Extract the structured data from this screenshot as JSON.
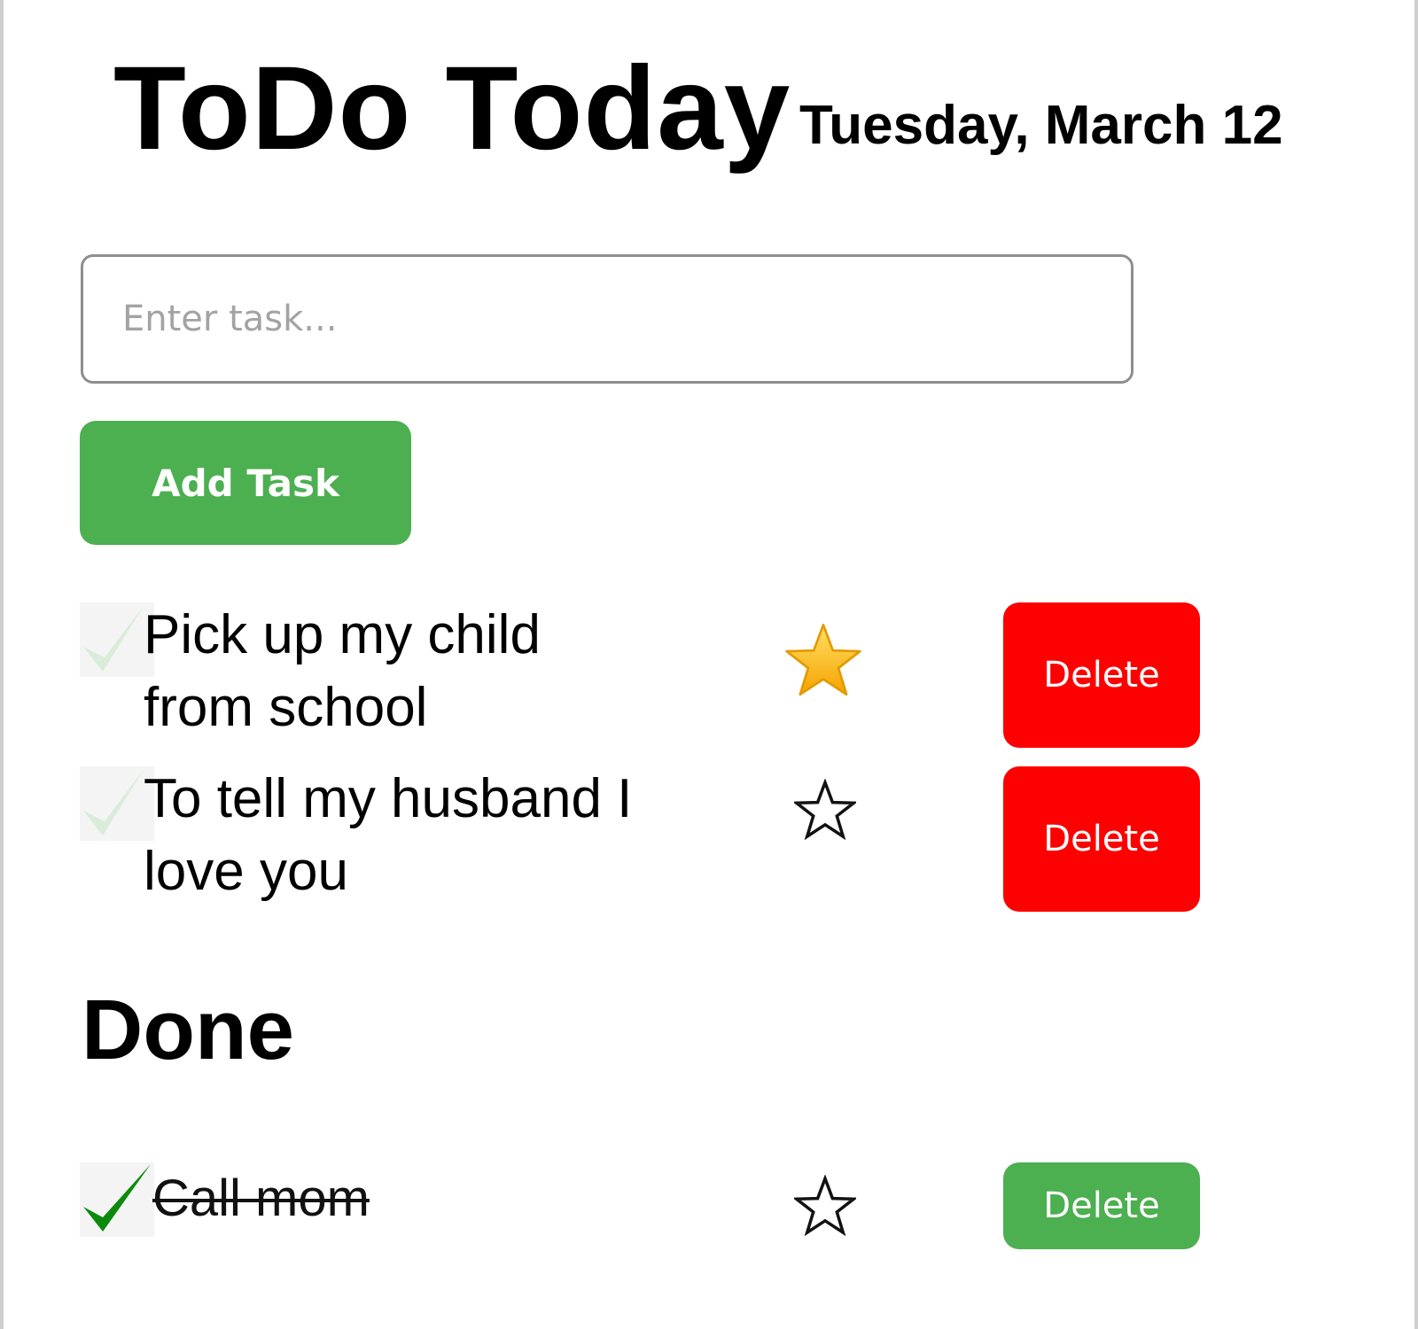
{
  "app": {
    "title": "ToDo Today",
    "date": "Tuesday, March 12"
  },
  "input": {
    "placeholder": "Enter task...",
    "value": ""
  },
  "add_button": {
    "label": "Add Task"
  },
  "tasks": [
    {
      "line1": "Pick up my child",
      "line2": "from school",
      "starred": true,
      "completed": false,
      "delete_label": "Delete"
    },
    {
      "line1": "To tell my husband I",
      "line2": "love you",
      "starred": false,
      "completed": false,
      "delete_label": "Delete"
    }
  ],
  "done_section": {
    "heading": "Done",
    "items": [
      {
        "text": "Call mom",
        "starred": false,
        "completed": true,
        "delete_label": "Delete"
      }
    ]
  },
  "colors": {
    "add_button": "#4caf50",
    "delete_active": "#fd0000",
    "delete_done": "#4caf50",
    "check_done": "#0b8a0b",
    "check_pending": "#d9ecd9",
    "star_filled": "#fbbf24"
  },
  "icons": {
    "check": "check-icon",
    "star_filled": "star-filled-icon",
    "star_outline": "star-outline-icon"
  }
}
